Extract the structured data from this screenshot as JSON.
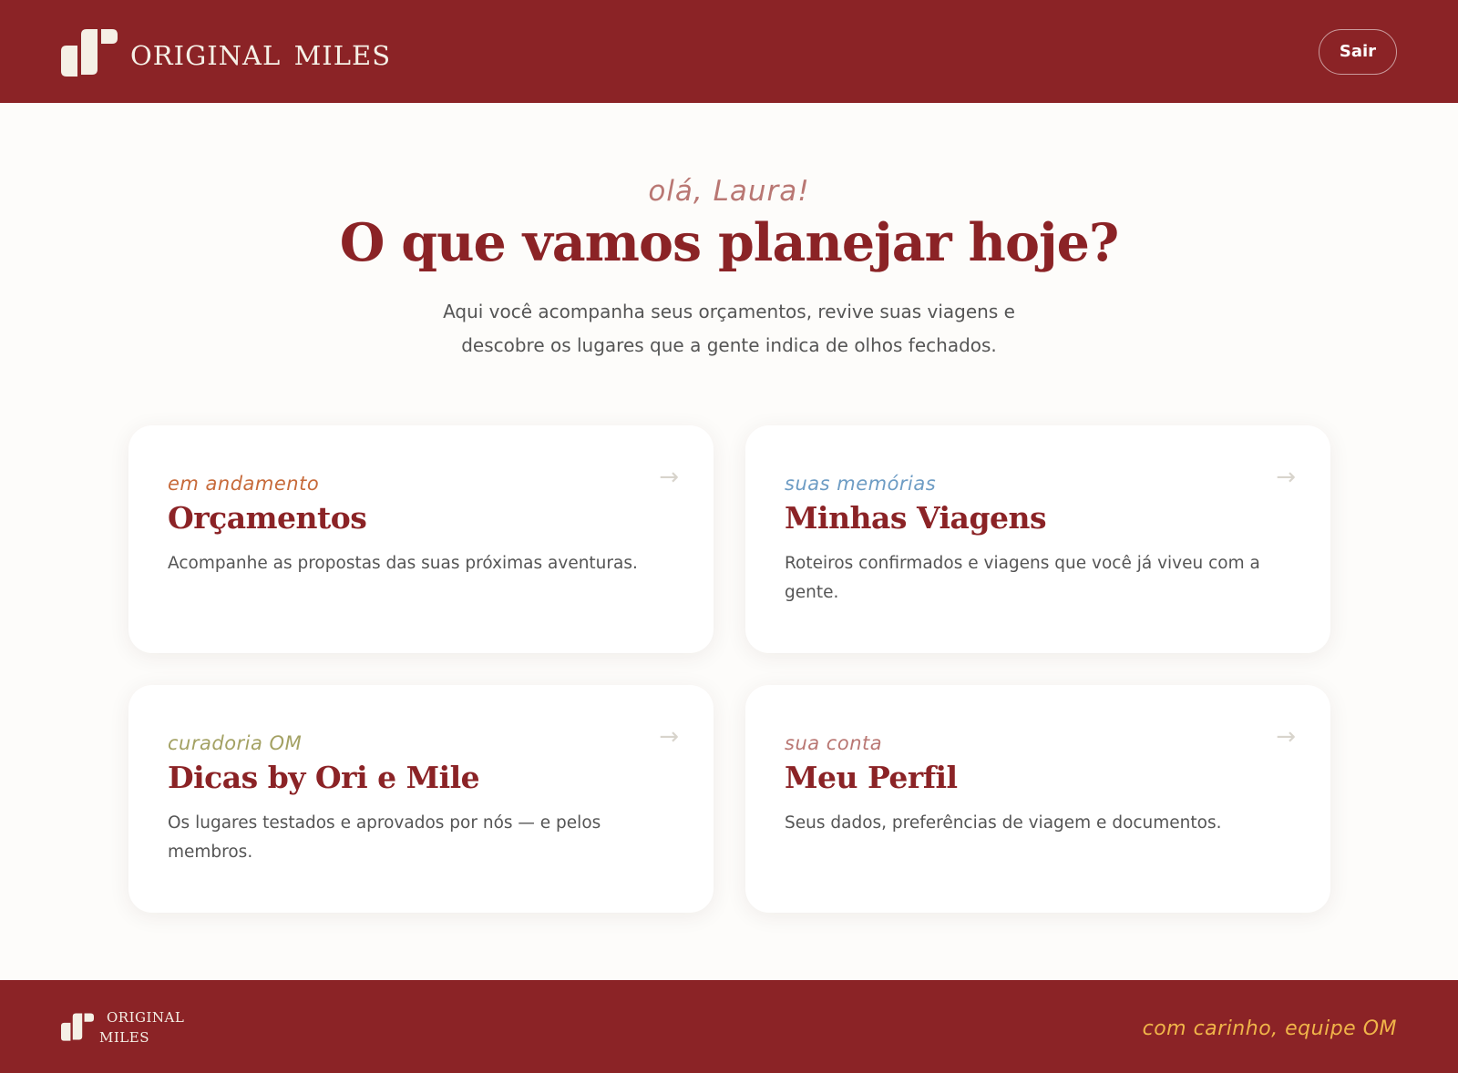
{
  "header": {
    "brand_name": "Original Miles",
    "logout_label": "Sair"
  },
  "hero": {
    "greeting": "olá, Laura!",
    "title": "O que vamos planejar hoje?",
    "subtitle": "Aqui você acompanha seus orçamentos, revive suas viagens e descobre os lugares que a gente indica de olhos fechados."
  },
  "cards": [
    {
      "tag": "em andamento",
      "title": "Orçamentos",
      "description": "Acompanhe as propostas das suas próximas aventuras.",
      "arrow": "→"
    },
    {
      "tag": "suas memórias",
      "title": "Minhas Viagens",
      "description": "Roteiros confirmados e viagens que você já viveu com a gente.",
      "arrow": "→"
    },
    {
      "tag": "curadoria OM",
      "title": "Dicas by Ori e Mile",
      "description": "Os lugares testados e aprovados por nós — e pelos membros.",
      "arrow": "→"
    },
    {
      "tag": "sua conta",
      "title": "Meu Perfil",
      "description": "Seus dados, preferências de viagem e documentos.",
      "arrow": "→"
    }
  ],
  "footer": {
    "brand_line1": "Original",
    "brand_line2": "Miles",
    "signature": "com carinho, equipe OM"
  },
  "colors": {
    "brand_red": "#8b2326",
    "cream": "#f5f0e6",
    "tag_orange": "#c76a3a",
    "tag_blue": "#6d9cc4",
    "tag_olive": "#a3a163",
    "tag_rose": "#b97773",
    "footer_signature": "#f0b449"
  },
  "icons": {
    "brand_logo": "original-miles-logo-icon",
    "card_arrow": "arrow-right-icon"
  }
}
